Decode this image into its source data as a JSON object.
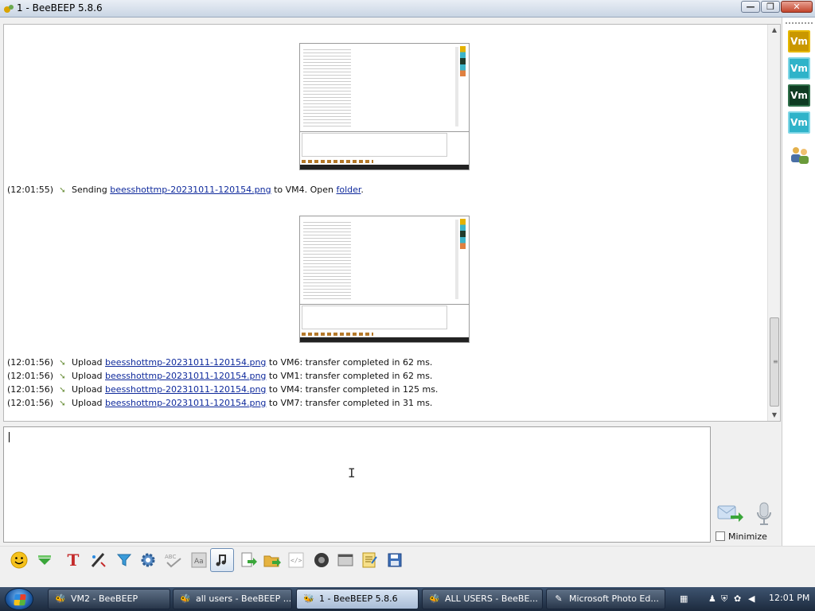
{
  "window": {
    "title": "1 - BeeBEEP 5.8.6"
  },
  "chat": {
    "messages": [
      {
        "time": "(12:01:55)",
        "prefix": "Sending ",
        "file": "beesshottmp-20231011-120154.png",
        "suffix": " to VM4. Open ",
        "link2": "folder",
        "end": "."
      },
      {
        "time": "(12:01:56)",
        "prefix": "Upload ",
        "file": "beesshottmp-20231011-120154.png",
        "suffix": " to VM6: transfer completed in 62 ms."
      },
      {
        "time": "(12:01:56)",
        "prefix": "Upload ",
        "file": "beesshottmp-20231011-120154.png",
        "suffix": " to VM1: transfer completed in 62 ms."
      },
      {
        "time": "(12:01:56)",
        "prefix": "Upload ",
        "file": "beesshottmp-20231011-120154.png",
        "suffix": " to VM4: transfer completed in 125 ms."
      },
      {
        "time": "(12:01:56)",
        "prefix": "Upload ",
        "file": "beesshottmp-20231011-120154.png",
        "suffix": " to VM7: transfer completed in 31 ms."
      }
    ]
  },
  "users": [
    {
      "label": "Vm",
      "color": "#c99700",
      "border": "#e6b800"
    },
    {
      "label": "Vm",
      "color": "#2fb3c9",
      "border": "#7fd6e6"
    },
    {
      "label": "Vm",
      "color": "#0e3b22",
      "border": "#2f6f4a"
    },
    {
      "label": "Vm",
      "color": "#2fb3c9",
      "border": "#7fd6e6"
    }
  ],
  "input": {
    "minimize_label": "Minimize"
  },
  "taskbar": {
    "tasks": [
      {
        "label": "VM2 - BeeBEEP"
      },
      {
        "label": "all users - BeeBEEP ..."
      },
      {
        "label": "1 - BeeBEEP 5.8.6"
      },
      {
        "label": "ALL USERS - BeeBE..."
      },
      {
        "label": "Microsoft Photo Ed..."
      }
    ],
    "clock": "12:01 PM"
  }
}
